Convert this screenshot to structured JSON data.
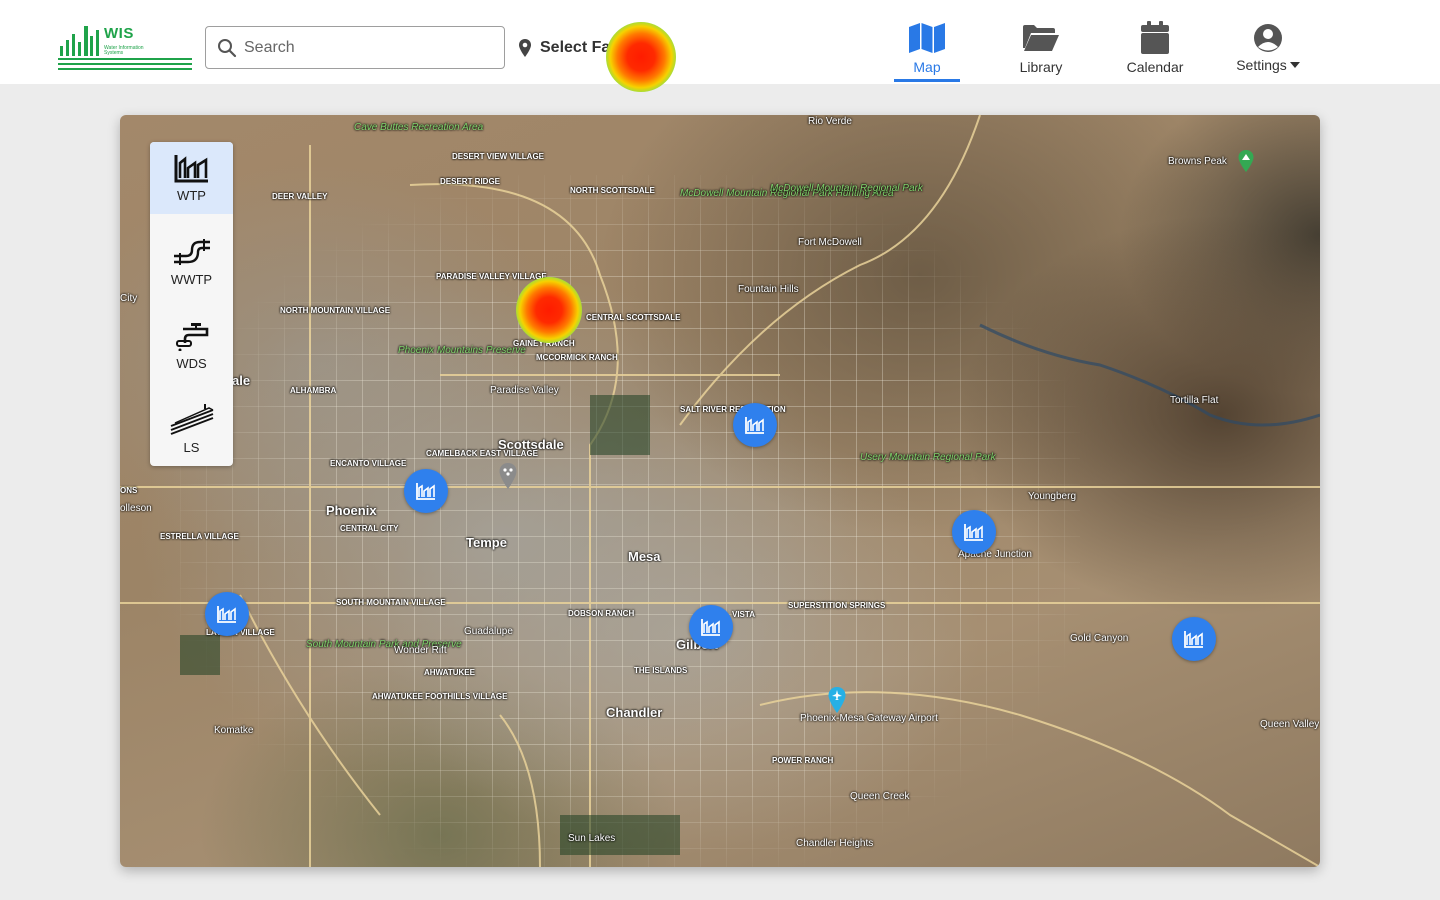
{
  "app": {
    "logo_title": "WIS",
    "logo_subtitle": "Water Information Systems"
  },
  "search": {
    "placeholder": "Search"
  },
  "facility_select": {
    "label": "Select Facility"
  },
  "nav": {
    "map": "Map",
    "library": "Library",
    "calendar": "Calendar",
    "settings": "Settings"
  },
  "colors": {
    "accent": "#2979e6",
    "marker": "#2f80ed",
    "logo_green": "#1fa34a"
  },
  "facility_types": [
    {
      "label": "WTP",
      "icon": "water-treatment-plant-icon",
      "selected": true
    },
    {
      "label": "WWTP",
      "icon": "wastewater-pipe-icon",
      "selected": false
    },
    {
      "label": "WDS",
      "icon": "water-faucet-icon",
      "selected": false
    },
    {
      "label": "LS",
      "icon": "lift-station-icon",
      "selected": false
    }
  ],
  "map": {
    "labels": {
      "phoenix": "Phoenix",
      "scottsdale": "Scottsdale",
      "tempe": "Tempe",
      "mesa": "Mesa",
      "chandler": "Chandler",
      "gilbert": "Gilbert",
      "guadalupe": "Guadalupe",
      "fountain_hills": "Fountain Hills",
      "fort_mcdowell": "Fort McDowell",
      "rio_verde": "Rio Verde",
      "browns_peak": "Browns Peak",
      "tortilla_flat": "Tortilla Flat",
      "youngberg": "Youngberg",
      "gold_canyon": "Gold Canyon",
      "queen_valley": "Queen Valley",
      "queen_creek": "Queen Creek",
      "komatke": "Komatke",
      "apache_junction": "Apache Junction",
      "wonder_rift": "Wonder Rift",
      "paradise_valley": "Paradise Valley",
      "phoenix_mesa_airport": "Phoenix-Mesa Gateway Airport",
      "chandler_heights": "Chandler Heights",
      "sun_lakes": "Sun Lakes",
      "cave_buttes": "Cave Buttes Recreation Area",
      "mcdowell_hunting": "McDowell Mountain Regional Park Hunting Area",
      "mcdowell_park": "McDowell Mountain Regional Park",
      "phoenix_mountains": "Phoenix Mountains Preserve",
      "usery_park": "Usery Mountain Regional Park",
      "south_mountain": "South Mountain Park and Preserve",
      "desert_view": "DESERT VIEW VILLAGE",
      "deer_valley": "DEER VALLEY",
      "desert_ridge": "DESERT RIDGE",
      "north_scottsdale": "NORTH SCOTTSDALE",
      "paradise_valley_village": "PARADISE VALLEY VILLAGE",
      "north_mountain": "NORTH MOUNTAIN VILLAGE",
      "central_scottsdale": "CENTRAL SCOTTSDALE",
      "gainey_ranch": "GAINEY RANCH",
      "mccormick_ranch": "MCCORMICK RANCH",
      "alhambra": "ALHAMBRA",
      "salt_river": "SALT RIVER RESERVATION",
      "encanto": "ENCANTO VILLAGE",
      "camelback": "CAMELBACK EAST VILLAGE",
      "central_city": "CENTRAL CITY",
      "estrella": "ESTRELLA VILLAGE",
      "laveen": "LAVEEN VILLAGE",
      "south_mountain_village": "SOUTH MOUNTAIN VILLAGE",
      "ahwatukee": "AHWATUKEE",
      "ahwatukee_foothills": "AHWATUKEE FOOTHILLS VILLAGE",
      "dobson_ranch": "DOBSON RANCH",
      "the_islands": "THE ISLANDS",
      "superstition_springs": "SUPERSTITION SPRINGS",
      "power_ranch": "POWER RANCH",
      "vista": "VISTA",
      "city": "City",
      "ale": "ale",
      "olleson": "olleson",
      "ons": "ONS"
    },
    "markers": [
      {
        "name": "facility-marker-1",
        "icon": "water-treatment-plant-icon"
      },
      {
        "name": "facility-marker-2",
        "icon": "water-treatment-plant-icon"
      },
      {
        "name": "facility-marker-3",
        "icon": "water-treatment-plant-icon"
      },
      {
        "name": "facility-marker-4",
        "icon": "water-treatment-plant-icon"
      },
      {
        "name": "facility-marker-5",
        "icon": "water-treatment-plant-icon"
      },
      {
        "name": "facility-marker-6",
        "icon": "water-treatment-plant-icon"
      }
    ]
  }
}
